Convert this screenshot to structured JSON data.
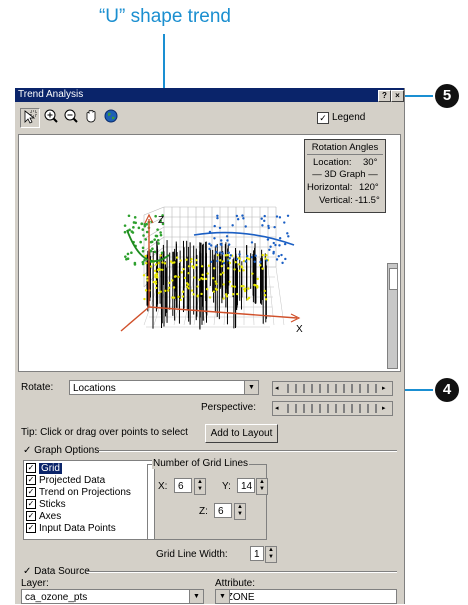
{
  "callout": {
    "title": "“U” shape trend",
    "badge_top": "5",
    "badge_right": "4"
  },
  "window": {
    "title": "Trend Analysis",
    "help_btn": "?",
    "close_btn": "×"
  },
  "toolbar": {
    "legend_label": "Legend",
    "legend_checked": true,
    "tools": [
      "select-icon",
      "zoom-in-icon",
      "zoom-out-icon",
      "pan-icon",
      "globe-icon"
    ]
  },
  "rotation_angles": {
    "title": "Rotation Angles",
    "location_label": "Location:",
    "location_value": "30°",
    "graph_header": "— 3D Graph —",
    "horizontal_label": "Horizontal:",
    "horizontal_value": "120°",
    "vertical_label": "Vertical:",
    "vertical_value": "-11.5°"
  },
  "plot": {
    "axis_z": "Z",
    "axis_x": "X"
  },
  "rotate": {
    "label": "Rotate:",
    "value": "Locations"
  },
  "perspective": {
    "label": "Perspective:"
  },
  "tip": {
    "text": "Tip:   Click or drag over points to select",
    "button": "Add to Layout"
  },
  "graph_options": {
    "title": "Graph Options",
    "items": [
      {
        "label": "Grid",
        "checked": true,
        "selected": true
      },
      {
        "label": "Projected Data",
        "checked": true
      },
      {
        "label": "Trend on Projections",
        "checked": true
      },
      {
        "label": "Sticks",
        "checked": true
      },
      {
        "label": "Axes",
        "checked": true
      },
      {
        "label": "Input Data Points",
        "checked": true
      }
    ],
    "grid_lines_title": "Number of Grid Lines",
    "x_label": "X:",
    "x_value": "6",
    "y_label": "Y:",
    "y_value": "14",
    "z_label": "Z:",
    "z_value": "6",
    "grid_width_label": "Grid Line Width:",
    "grid_width_value": "1"
  },
  "data_source": {
    "title": "Data Source",
    "layer_label": "Layer:",
    "layer_value": "ca_ozone_pts",
    "attribute_label": "Attribute:",
    "attribute_value": "OZONE"
  },
  "colors": {
    "titlebar": "#0a246a",
    "accent": "#1a8fd2",
    "face": "#d4d0c8"
  }
}
